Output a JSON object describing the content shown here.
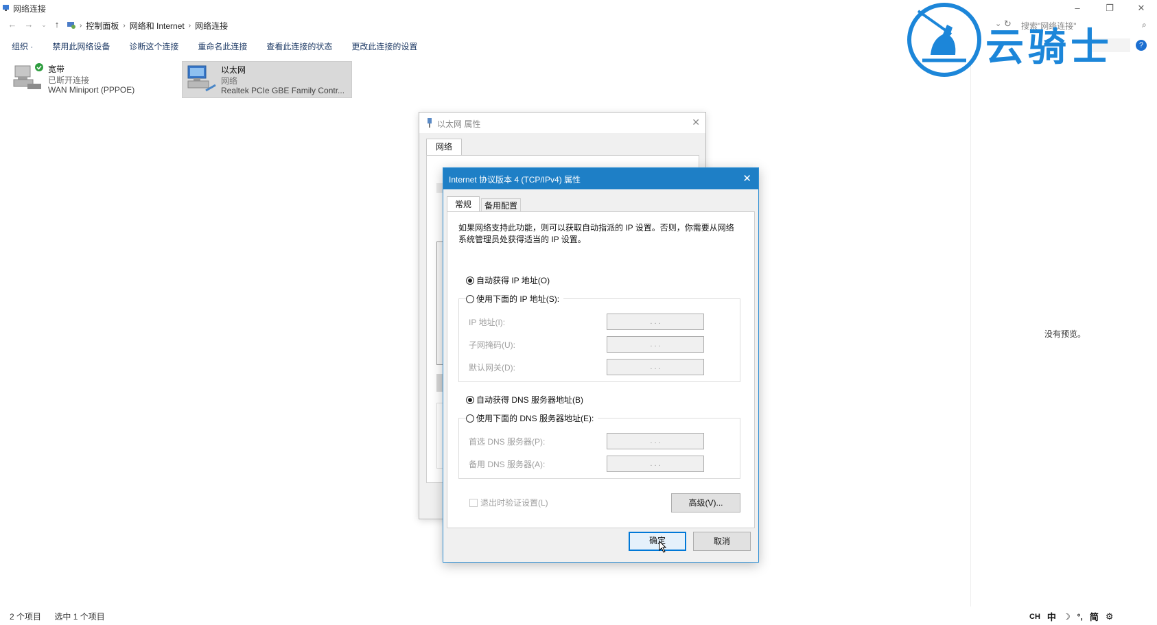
{
  "window": {
    "title": "网络连接"
  },
  "breadcrumb": [
    "控制面板",
    "网络和 Internet",
    "网络连接"
  ],
  "search": {
    "placeholder": "搜索\"网络连接\""
  },
  "toolbar": {
    "items": [
      "组织 ·",
      "禁用此网络设备",
      "诊断这个连接",
      "重命名此连接",
      "查看此连接的状态",
      "更改此连接的设置"
    ]
  },
  "connections": [
    {
      "name": "宽带",
      "status": "已断开连接",
      "device": "WAN Miniport (PPPOE)"
    },
    {
      "name": "以太网",
      "status": "网络",
      "device": "Realtek PCIe GBE Family Contr..."
    }
  ],
  "preview": {
    "text": "没有预览。"
  },
  "statusbar": {
    "count": "2 个项目",
    "selected": "选中 1 个项目"
  },
  "back_dialog": {
    "title": "以太网 属性",
    "tab": "网络"
  },
  "ipv4_dialog": {
    "title": "Internet 协议版本 4 (TCP/IPv4) 属性",
    "tabs": [
      "常规",
      "备用配置"
    ],
    "description": "如果网络支持此功能，则可以获取自动指派的 IP 设置。否则，你需要从网络系统管理员处获得适当的 IP 设置。",
    "auto_ip_label": "自动获得 IP 地址(O)",
    "manual_ip_label": "使用下面的 IP 地址(S):",
    "ip_fields": [
      "IP 地址(I):",
      "子网掩码(U):",
      "默认网关(D):"
    ],
    "auto_dns_label": "自动获得 DNS 服务器地址(B)",
    "manual_dns_label": "使用下面的 DNS 服务器地址(E):",
    "dns_fields": [
      "首选 DNS 服务器(P):",
      "备用 DNS 服务器(A):"
    ],
    "ip_placeholder_dots": ".   .   .",
    "validate_label": "退出时验证设置(L)",
    "advanced_button": "高级(V)...",
    "ok_button": "确定",
    "cancel_button": "取消"
  },
  "watermark": {
    "text": "云骑士"
  },
  "ime_tray": [
    "CH",
    "中",
    "简"
  ],
  "colors": {
    "accent": "#1e7fc6",
    "watermark": "#1c86d9",
    "selected": "#d9d9d9"
  }
}
